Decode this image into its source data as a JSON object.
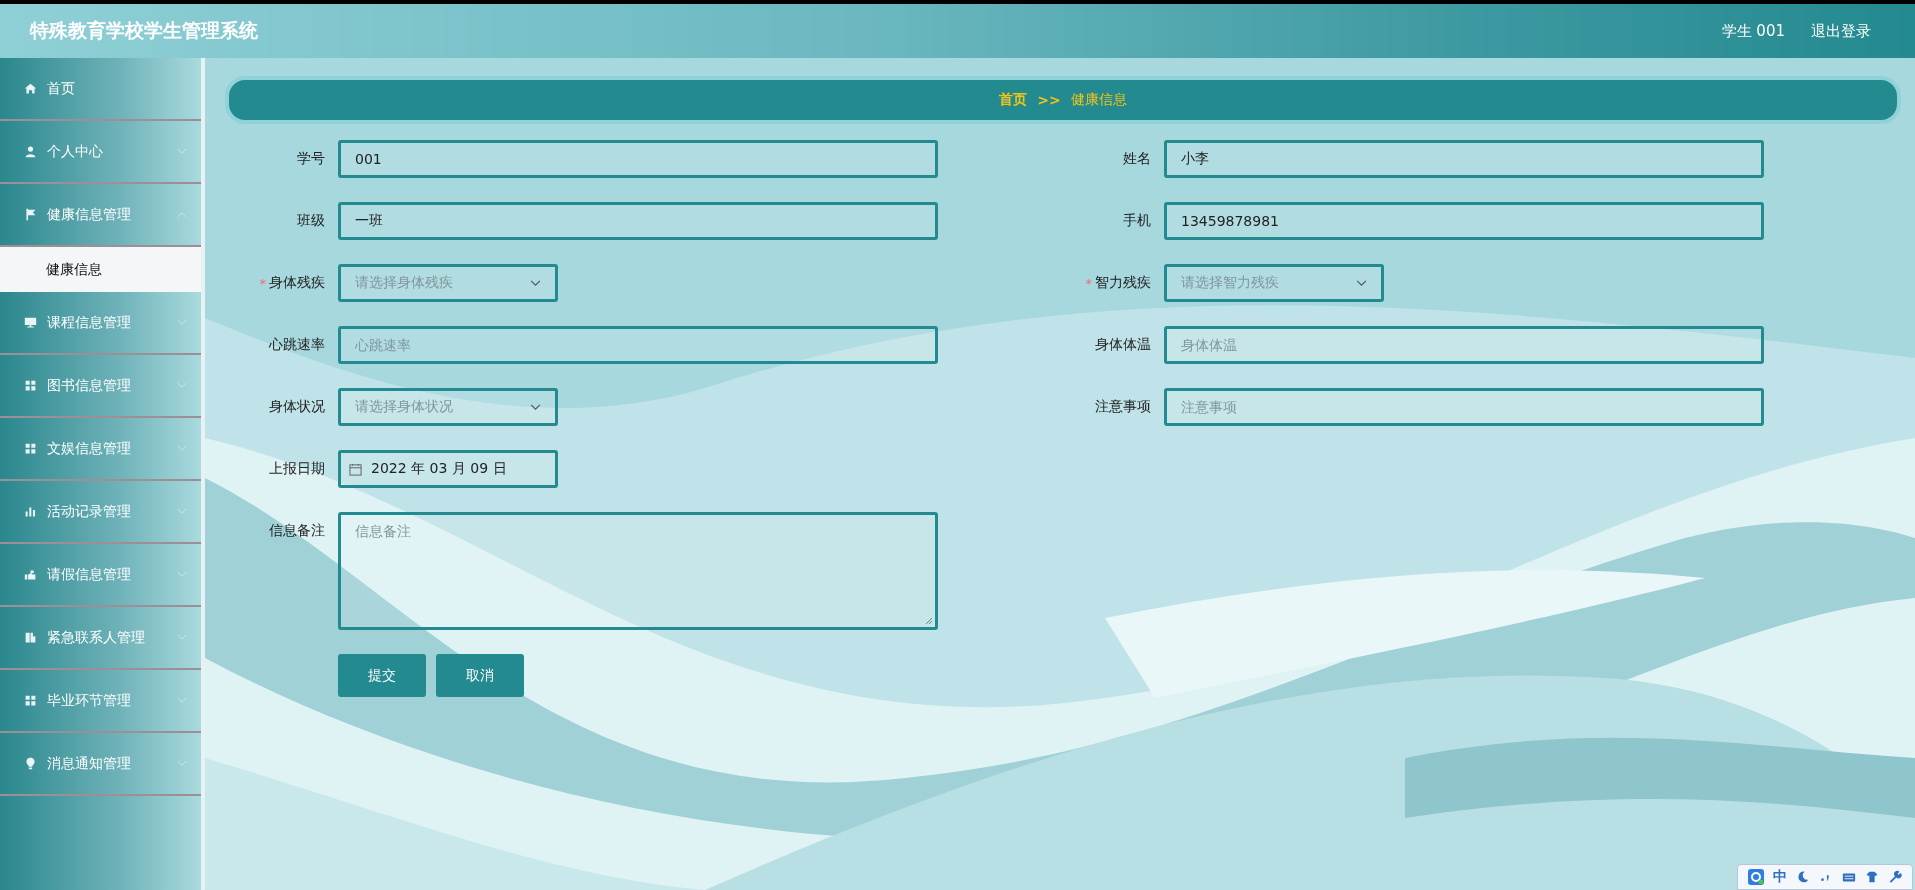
{
  "header": {
    "title": "特殊教育学校学生管理系统",
    "user": "学生 001",
    "logout": "退出登录"
  },
  "sidebar": {
    "items": [
      {
        "label": "首页"
      },
      {
        "label": "个人中心",
        "expanded": false
      },
      {
        "label": "健康信息管理",
        "expanded": true,
        "children": [
          {
            "label": "健康信息",
            "selected": true
          }
        ]
      },
      {
        "label": "课程信息管理",
        "expanded": false
      },
      {
        "label": "图书信息管理",
        "expanded": false
      },
      {
        "label": "文娱信息管理",
        "expanded": false
      },
      {
        "label": "活动记录管理",
        "expanded": false
      },
      {
        "label": "请假信息管理",
        "expanded": false
      },
      {
        "label": "紧急联系人管理",
        "expanded": false
      },
      {
        "label": "毕业环节管理",
        "expanded": false
      },
      {
        "label": "消息通知管理",
        "expanded": false
      }
    ]
  },
  "breadcrumb": {
    "items": [
      "首页",
      "健康信息"
    ],
    "separator": ">>"
  },
  "form": {
    "fields": [
      {
        "kind": "text",
        "label": "学号",
        "value": "001",
        "required": false
      },
      {
        "kind": "text",
        "label": "姓名",
        "value": "小李",
        "required": false
      },
      {
        "kind": "text",
        "label": "班级",
        "value": "一班",
        "required": false
      },
      {
        "kind": "text",
        "label": "手机",
        "value": "13459878981",
        "required": false
      },
      {
        "kind": "select",
        "label": "身体残疾",
        "placeholder": "请选择身体残疾",
        "required": true
      },
      {
        "kind": "select",
        "label": "智力残疾",
        "placeholder": "请选择智力残疾",
        "required": true
      },
      {
        "kind": "text",
        "label": "心跳速率",
        "placeholder": "心跳速率",
        "required": false
      },
      {
        "kind": "text",
        "label": "身体体温",
        "placeholder": "身体体温",
        "required": false
      },
      {
        "kind": "select",
        "label": "身体状况",
        "placeholder": "请选择身体状况",
        "required": false
      },
      {
        "kind": "text",
        "label": "注意事项",
        "placeholder": "注意事项",
        "required": false
      },
      {
        "kind": "date",
        "label": "上报日期",
        "value": "2022 年 03 月 09 日",
        "required": false
      },
      {
        "kind": "textarea",
        "label": "信息备注",
        "placeholder": "信息备注",
        "required": false
      }
    ],
    "required_mark": "*",
    "buttons": [
      "提交",
      "取消"
    ]
  },
  "ime_bar": {
    "label": "中"
  }
}
